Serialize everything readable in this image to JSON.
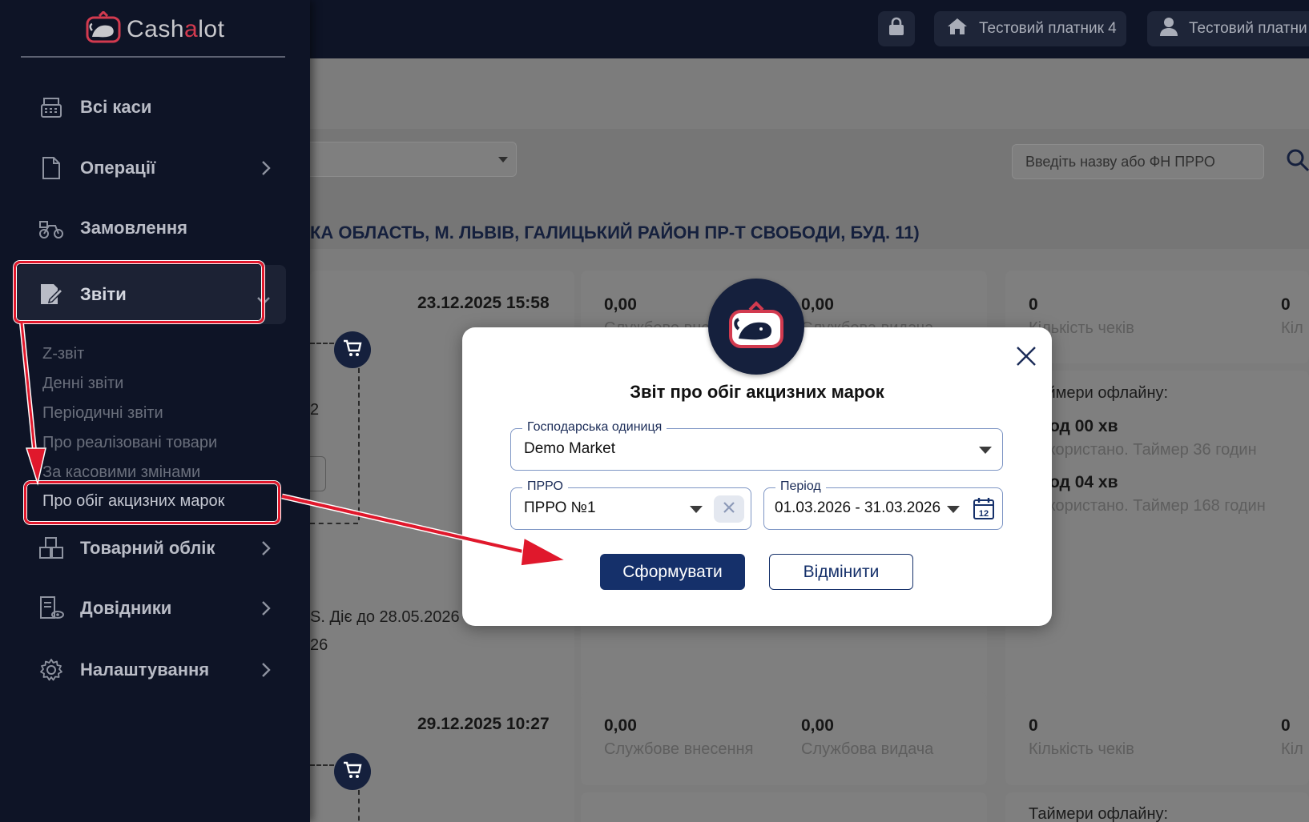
{
  "topbar": {
    "payer_label": "Тестовий платник 4",
    "user_label": "Тестовий платни"
  },
  "brand": {
    "name_prefix": "Cash",
    "name_accent": "a",
    "name_suffix": "lot"
  },
  "sidebar": {
    "items": [
      {
        "label": "Всі каси",
        "icon": "cash-register-icon"
      },
      {
        "label": "Операції",
        "icon": "document-icon"
      },
      {
        "label": "Замовлення",
        "icon": "delivery-bike-icon"
      },
      {
        "label": "Звіти",
        "icon": "report-edit-icon"
      },
      {
        "label": "Товарний облік",
        "icon": "boxes-icon"
      },
      {
        "label": "Довідники",
        "icon": "catalog-icon"
      },
      {
        "label": "Налаштування",
        "icon": "gear-icon"
      }
    ],
    "reports_submenu": [
      "Z-звіт",
      "Денні звіти",
      "Періодичні звіти",
      "Про реалізовані товари",
      "За касовими змінами",
      "Про обіг акцизних марок"
    ]
  },
  "background": {
    "search_placeholder": "Введіть назву або ФН ПРРО",
    "address": "КА ОБЛАСТЬ, М. ЛЬВІВ, ГАЛИЦЬКИЙ РАЙОН ПР-Т СВОБОДИ, БУД. 11)",
    "card1": {
      "datetime": "23.12.2025 15:58",
      "deposit_value": "0,00",
      "withdraw_value": "0,00",
      "deposit_label": "Службове внесення",
      "withdraw_label": "Службова видача",
      "checks_value": "0",
      "checks_label": "Кількість чеків",
      "extra_value": "0",
      "extra_label": "Кіл",
      "fragment_2": "2",
      "timers_title": "Таймери офлайну:",
      "timer1": "0 год 00 хв",
      "timer1_note": "Використано. Таймер 36 годин",
      "timer2": "0 год 04 хв",
      "timer2_note": "Використано. Таймер 168 годин",
      "validity": "S. Діє до 28.05.2026",
      "validity_2": "26"
    },
    "card2": {
      "datetime": "29.12.2025 10:27",
      "deposit_value": "0,00",
      "withdraw_value": "0,00",
      "deposit_label": "Службове внесення",
      "withdraw_label": "Службова видача",
      "checks_value": "0",
      "checks_label": "Кількість чеків",
      "extra_value": "0",
      "extra_label": "Кіл",
      "timers_title": "Таймери офлайну:"
    }
  },
  "modal": {
    "title": "Звіт про обіг акцизних марок",
    "business_unit": {
      "label": "Господарська одиниця",
      "value": "Demo Market"
    },
    "prro": {
      "label": "ПРРО",
      "value": "ПРРО №1"
    },
    "period": {
      "label": "Період",
      "value": "01.03.2026 - 31.03.2026",
      "calendar_day": "12"
    },
    "submit_label": "Сформувати",
    "cancel_label": "Відмінити"
  },
  "colors": {
    "sidebar_bg": "#0e1426",
    "primary": "#15306a",
    "highlight": "#e0182c",
    "brand_accent": "#d23a4f"
  }
}
